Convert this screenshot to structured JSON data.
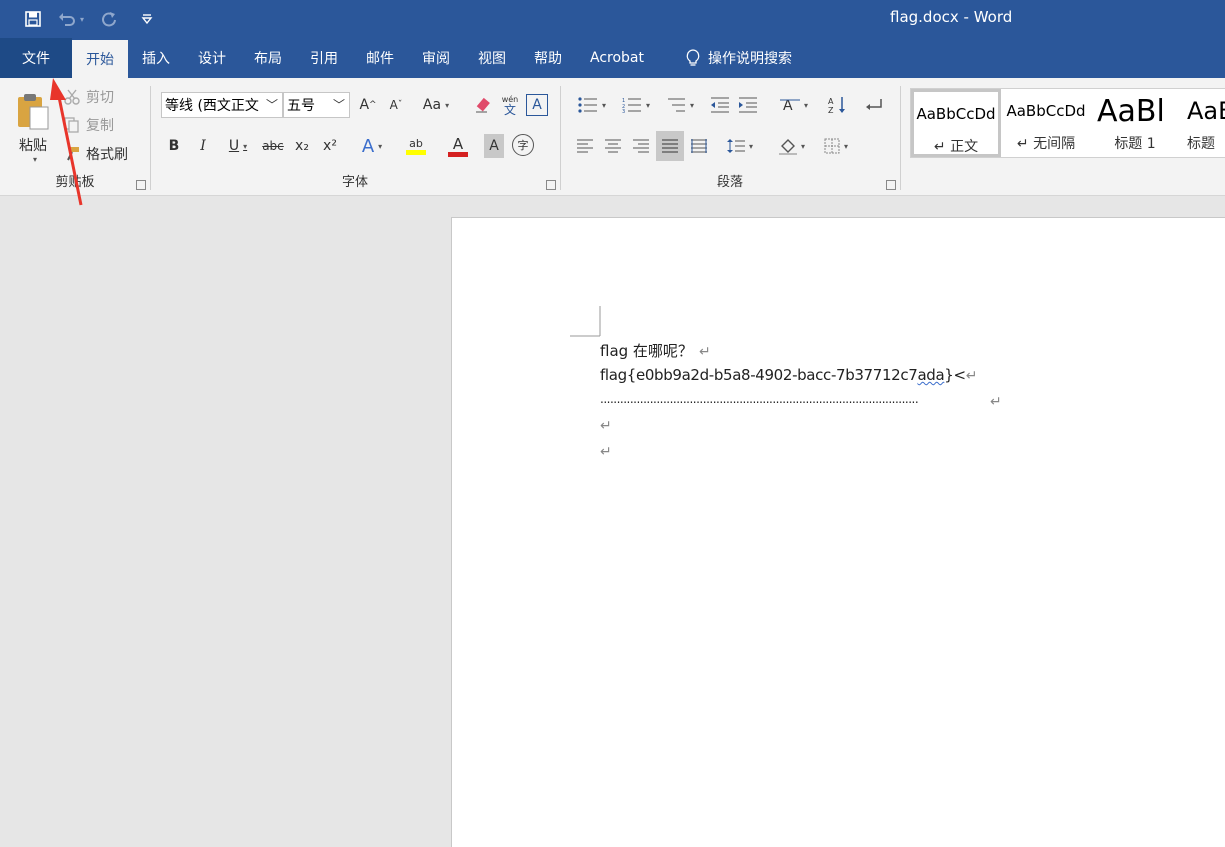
{
  "window": {
    "title": "flag.docx  -  Word"
  },
  "qat": {
    "save_icon": "save-icon",
    "undo_icon": "undo-icon",
    "redo_icon": "redo-icon",
    "customize_icon": "customize-qat-icon"
  },
  "tabs": [
    {
      "label": "文件"
    },
    {
      "label": "开始"
    },
    {
      "label": "插入"
    },
    {
      "label": "设计"
    },
    {
      "label": "布局"
    },
    {
      "label": "引用"
    },
    {
      "label": "邮件"
    },
    {
      "label": "审阅"
    },
    {
      "label": "视图"
    },
    {
      "label": "帮助"
    },
    {
      "label": "Acrobat"
    },
    {
      "label": "操作说明搜索"
    }
  ],
  "clipboard": {
    "paste": "粘贴",
    "cut": "剪切",
    "copy": "复制",
    "format_painter": "格式刷",
    "group_label": "剪贴板"
  },
  "font": {
    "name": "等线 (西文正文",
    "size": "五号",
    "grow": "A",
    "shrink": "A",
    "case": "Aa",
    "phonetic_top": "wén",
    "phonetic_bottom": "文",
    "border_char": "A",
    "bold": "B",
    "italic": "I",
    "underline": "U",
    "strike": "abc",
    "subscript": "x₂",
    "superscript": "x²",
    "effects": "A",
    "highlight": "ab",
    "font_color": "A",
    "shading": "A",
    "enclose": "字",
    "group_label": "字体"
  },
  "paragraph": {
    "group_label": "段落"
  },
  "styles": [
    {
      "preview": "AaBbCcDd",
      "name": "↵ 正文"
    },
    {
      "preview": "AaBbCcDd",
      "name": "↵ 无间隔"
    },
    {
      "preview": "AaBl",
      "name": "标题 1"
    },
    {
      "preview": "AaB",
      "name": "标题"
    }
  ],
  "document": {
    "line1": "flag 在哪呢？",
    "line2_prefix": "flag{e0bb9a2d-b5a8-4902-bacc-7b37712c7",
    "line2_squiggle": "ada",
    "line2_suffix": "}<",
    "line3": "................................................................................................",
    "para_mark": "↵"
  },
  "colors": {
    "accent": "#2b579a",
    "highlight": "#ffff00",
    "font_color": "#d42020",
    "annotation_arrow": "#e8352b"
  }
}
